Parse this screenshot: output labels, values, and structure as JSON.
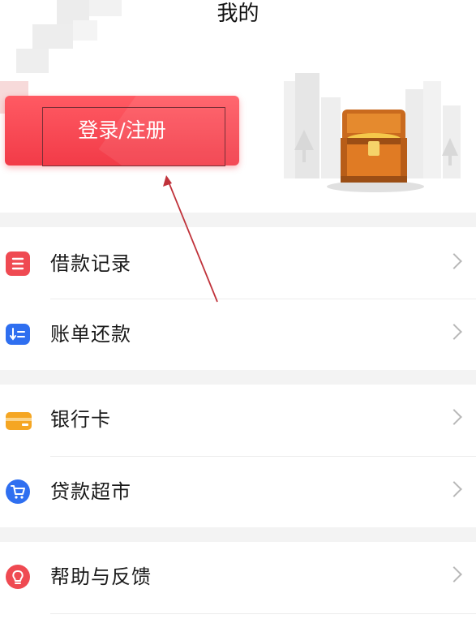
{
  "header": {
    "title": "我的"
  },
  "login": {
    "label": "登录/注册"
  },
  "menu": [
    {
      "label": "借款记录",
      "icon": "list-icon",
      "color": "#ef4a52"
    },
    {
      "label": "账单还款",
      "icon": "bill-sort-icon",
      "color": "#2f6ff0"
    },
    {
      "label": "银行卡",
      "icon": "bank-card-icon",
      "color": "#f5a623"
    },
    {
      "label": "贷款超市",
      "icon": "shopping-cart-icon",
      "color": "#2f6ff0"
    },
    {
      "label": "帮助与反馈",
      "icon": "lightbulb-icon",
      "color": "#ef4a52"
    }
  ],
  "colors": {
    "accent": "#f23b48",
    "background": "#f3f3f3",
    "annotation": "#c0323a"
  }
}
